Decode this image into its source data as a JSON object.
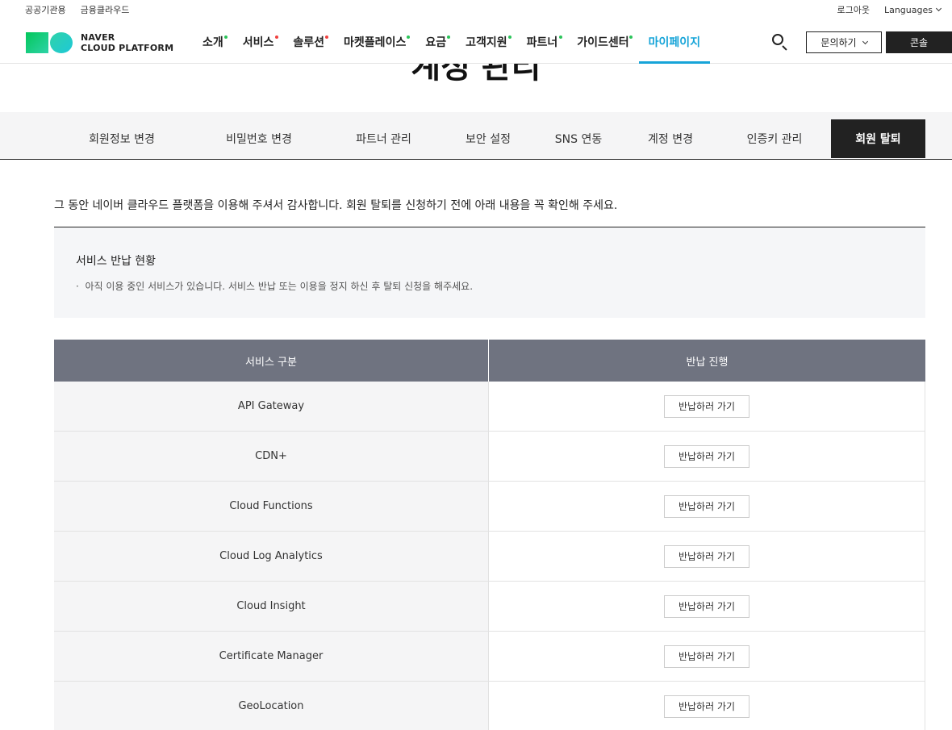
{
  "util": {
    "links": [
      "공공기관용",
      "금융클라우드"
    ],
    "logout": "로그아웃",
    "languages": "Languages"
  },
  "header": {
    "logo_line1": "NAVER",
    "logo_line2": "CLOUD PLATFORM",
    "nav": [
      {
        "label": "소개",
        "dot_color": "#2cc45a"
      },
      {
        "label": "서비스",
        "dot_color": "#f0413f"
      },
      {
        "label": "솔루션",
        "dot_color": "#f0413f"
      },
      {
        "label": "마켓플레이스",
        "dot_color": "#2cc45a"
      },
      {
        "label": "요금",
        "dot_color": "#2cc45a"
      },
      {
        "label": "고객지원",
        "dot_color": "#2cc45a"
      },
      {
        "label": "파트너",
        "dot_color": "#2cc45a"
      },
      {
        "label": "가이드센터",
        "dot_color": "#2cc45a"
      },
      {
        "label": "마이페이지",
        "dot_color": ""
      }
    ],
    "active_nav": "마이페이지",
    "search_icon": "search-icon",
    "inquiry": "문의하기",
    "console": "콘솔"
  },
  "page": {
    "title": "계정 관리"
  },
  "tabs": [
    "회원정보 변경",
    "비밀번호 변경",
    "파트너 관리",
    "보안 설정",
    "SNS 연동",
    "계정 변경",
    "인증키 관리",
    "회원 탈퇴"
  ],
  "active_tab": "회원 탈퇴",
  "intro": "그 동안 네이버 클라우드 플랫폼을 이용해 주셔서 감사합니다. 회원 탈퇴를 신청하기 전에 아래 내용을 꼭 확인해 주세요.",
  "notice": {
    "title": "서비스 반납 현황",
    "item": "아직 이용 중인 서비스가 있습니다. 서비스 반납 또는 이용을 정지 하신 후 탈퇴 신청을 해주세요."
  },
  "table": {
    "headers": [
      "서비스 구분",
      "반납 진행"
    ],
    "rows": [
      {
        "service": "API Gateway",
        "action": "반납하러 가기"
      },
      {
        "service": "CDN+",
        "action": "반납하러 가기"
      },
      {
        "service": "Cloud Functions",
        "action": "반납하러 가기"
      },
      {
        "service": "Cloud Log Analytics",
        "action": "반납하러 가기"
      },
      {
        "service": "Cloud Insight",
        "action": "반납하러 가기"
      },
      {
        "service": "Certificate Manager",
        "action": "반납하러 가기"
      },
      {
        "service": "GeoLocation",
        "action": "반납하러 가기"
      }
    ]
  },
  "colors": {
    "accent": "#16a4d8",
    "table_header": "#6f7380",
    "dark": "#222222"
  }
}
